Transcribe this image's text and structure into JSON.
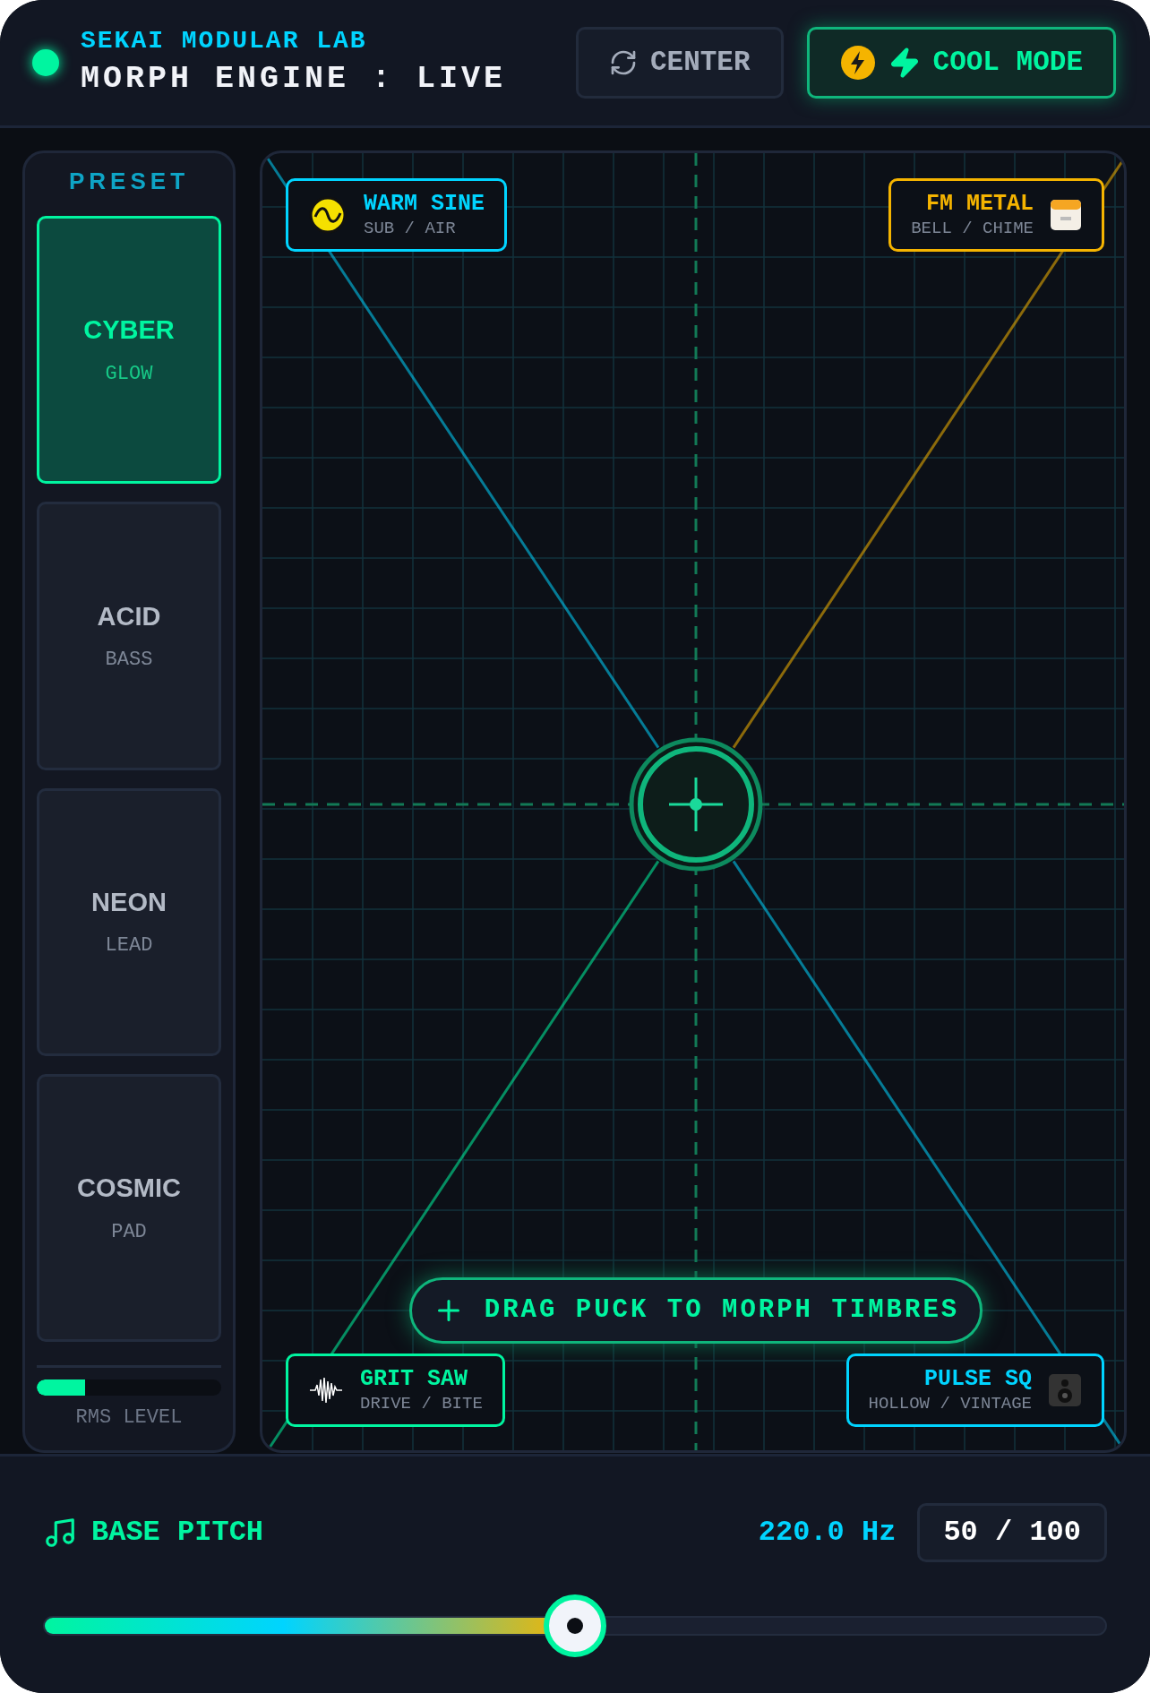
{
  "header": {
    "brand": "SEKAI MODULAR LAB",
    "title": "MORPH ENGINE : LIVE",
    "buttons": [
      {
        "label": "CENTER",
        "kind": "reset",
        "selected": false
      },
      {
        "label": "COOL MODE",
        "kind": "mode",
        "selected": true
      }
    ]
  },
  "presets": {
    "title": "PRESET",
    "items": [
      {
        "name": "CYBER",
        "sub": "GLOW",
        "selected": true
      },
      {
        "name": "ACID",
        "sub": "BASS",
        "selected": false
      },
      {
        "name": "NEON",
        "sub": "LEAD",
        "selected": false
      },
      {
        "name": "COSMIC",
        "sub": "PAD",
        "selected": false
      }
    ]
  },
  "meter": {
    "label": "RMS LEVEL",
    "level": 0.26
  },
  "pad": {
    "corners": [
      {
        "name": "WARM SINE",
        "sub": "SUB / AIR",
        "color": "#00d4ff",
        "kind": "sine"
      },
      {
        "name": "FM METAL",
        "sub": "BELL / CHIME",
        "color": "#f5b400",
        "kind": "fm"
      },
      {
        "name": "GRIT SAW",
        "sub": "DRIVE / BITE",
        "color": "#00f5a0",
        "kind": "saw"
      },
      {
        "name": "PULSE SQ",
        "sub": "HOLLOW / VINTAGE",
        "color": "#00d4ff",
        "kind": "square"
      }
    ],
    "hint": "DRAG PUCK TO MORPH TIMBRES"
  },
  "pitch": {
    "label": "BASE PITCH",
    "reading": "220.0 Hz",
    "value": "50 / 100",
    "level": 0.5
  }
}
